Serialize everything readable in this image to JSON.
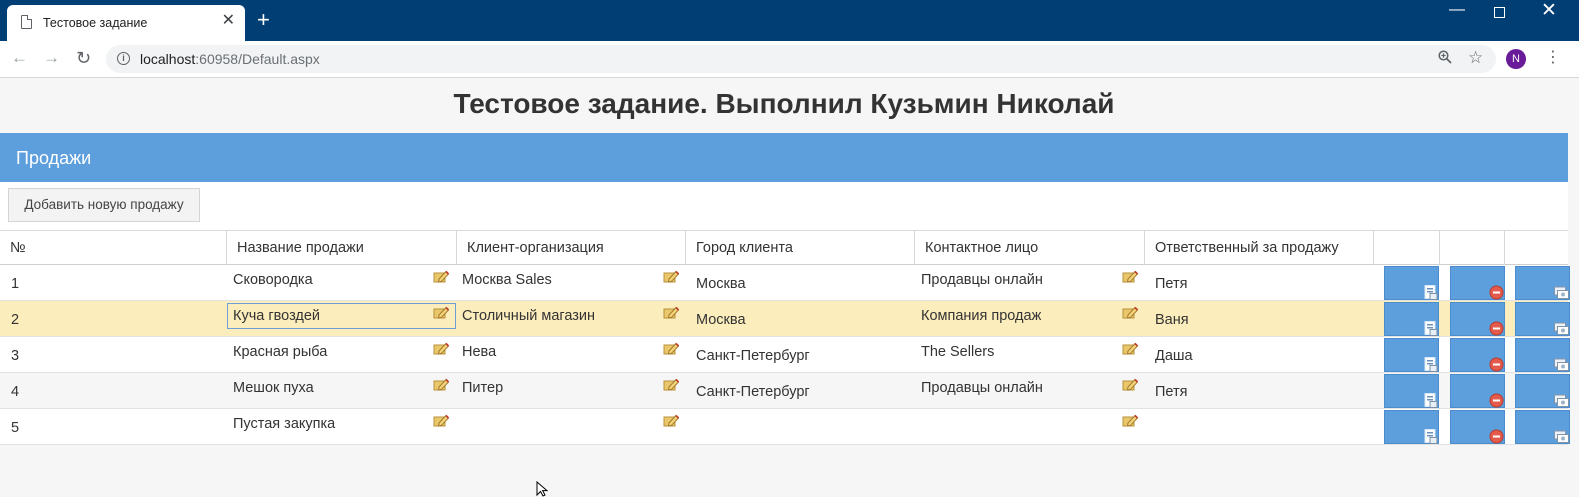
{
  "browser": {
    "tab_title": "Тестовое задание",
    "tab_close": "✕",
    "new_tab": "+",
    "url_host": "localhost",
    "url_rest": ":60958/Default.aspx",
    "avatar_letter": "N"
  },
  "page": {
    "title": "Тестовое задание. Выполнил Кузьмин Николай",
    "panel_title": "Продажи",
    "add_button": "Добавить новую продажу"
  },
  "table": {
    "headers": [
      "№",
      "Название продажи",
      "Клиент-организация",
      "Город клиента",
      "Контактное лицо",
      "Ответственный за продажу",
      "",
      "",
      ""
    ],
    "rows": [
      {
        "n": "1",
        "name": "Сковородка",
        "client": "Москва Sales",
        "city": "Москва",
        "contact": "Продавцы онлайн",
        "resp": "Петя"
      },
      {
        "n": "2",
        "name": "Куча гвоздей",
        "client": "Столичный магазин",
        "city": "Москва",
        "contact": "Компания продаж",
        "resp": "Ваня"
      },
      {
        "n": "3",
        "name": "Красная рыба",
        "client": "Нева",
        "city": "Санкт-Петербург",
        "contact": "The Sellers",
        "resp": "Даша"
      },
      {
        "n": "4",
        "name": "Мешок пуха",
        "client": "Питер",
        "city": "Санкт-Петербург",
        "contact": "Продавцы онлайн",
        "resp": "Петя"
      },
      {
        "n": "5",
        "name": "Пустая закупка",
        "client": "",
        "city": "",
        "contact": "",
        "resp": ""
      }
    ],
    "selected_row": 1
  },
  "colors": {
    "accent": "#5c9fdc",
    "chrome": "#003e74",
    "selected_row": "#fcedbd"
  },
  "icons": [
    "page-icon",
    "back-icon",
    "forward-icon",
    "reload-icon",
    "info-icon",
    "zoom-icon",
    "star-icon",
    "menu-icon",
    "edit-pencil-icon",
    "details-icon",
    "delete-icon",
    "goods-icon"
  ]
}
